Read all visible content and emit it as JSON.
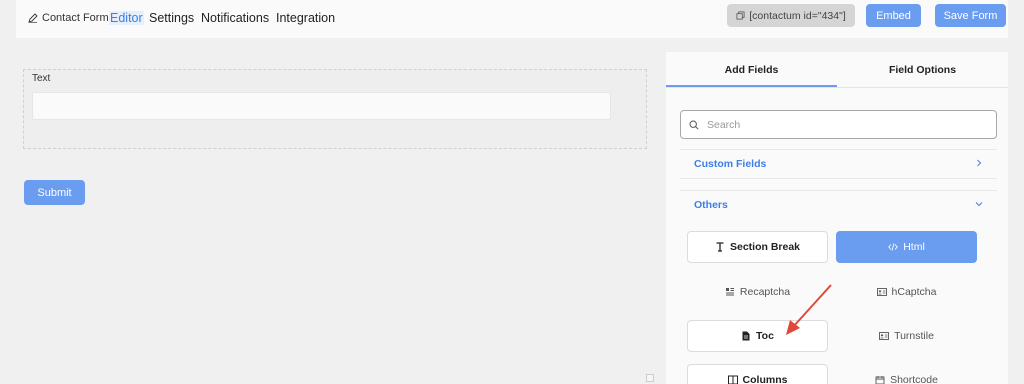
{
  "toolbar": {
    "title": "Contact Form",
    "nav": [
      "Editor",
      "Settings",
      "Notifications",
      "Integration"
    ],
    "shortcode": "[contactum id=\"434\"]",
    "embed_label": "Embed",
    "save_label": "Save Form"
  },
  "editor": {
    "field_label": "Text",
    "submit_label": "Submit"
  },
  "panel": {
    "tabs": [
      "Add Fields",
      "Field Options"
    ],
    "active_tab": "Add Fields",
    "search_placeholder": "Search",
    "sections": [
      "Custom Fields",
      "Others"
    ],
    "fields": [
      {
        "label": "Section Break",
        "icon": "text-cursor-icon"
      },
      {
        "label": "Html",
        "icon": "code-icon"
      },
      {
        "label": "Recaptcha",
        "icon": "grid-icon"
      },
      {
        "label": "hCaptcha",
        "icon": "id-card-icon"
      },
      {
        "label": "Toc",
        "icon": "document-icon"
      },
      {
        "label": "Turnstile",
        "icon": "id-card-icon"
      },
      {
        "label": "Columns",
        "icon": "columns-icon"
      },
      {
        "label": "Shortcode",
        "icon": "calendar-icon"
      }
    ]
  },
  "colors": {
    "accent": "#6a9cf0",
    "link": "#3f7de8",
    "annotation_arrow": "#e0483a"
  }
}
